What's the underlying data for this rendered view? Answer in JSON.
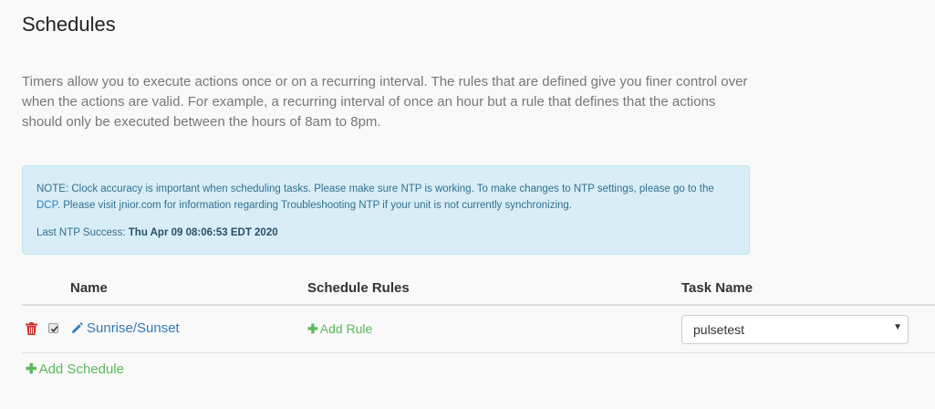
{
  "page": {
    "title": "Schedules",
    "description": "Timers allow you to execute actions once or on a recurring interval. The rules that are defined give you finer control over when the actions are valid. For example, a recurring interval of once an hour but a rule that defines that the actions should only be executed between the hours of 8am to 8pm."
  },
  "note": {
    "text_before": "NOTE: Clock accuracy is important when scheduling tasks. Please make sure NTP is working. To make changes to NTP settings, please go to the ",
    "link": "DCP",
    "text_after": ". Please visit jnior.com for information regarding Troubleshooting NTP if your unit is not currently synchronizing.",
    "ntp_label": "Last NTP Success:",
    "ntp_value": "Thu Apr 09 08:06:53 EDT 2020"
  },
  "table": {
    "headers": {
      "name": "Name",
      "rules": "Schedule Rules",
      "task": "Task Name"
    },
    "rows": [
      {
        "name": "Sunrise/Sunset",
        "enabled": true,
        "add_rule_label": "Add Rule",
        "task_selected": "pulsetest"
      }
    ]
  },
  "add_schedule_label": "Add Schedule",
  "icons": {
    "delete": "trash-icon",
    "edit": "pencil-icon",
    "add": "plus-icon",
    "dropdown": "caret-down-icon"
  },
  "colors": {
    "link": "#337ab7",
    "success": "#5cb85c",
    "danger": "#c9302c",
    "info_bg": "#d9edf7",
    "info_text": "#31708f"
  }
}
